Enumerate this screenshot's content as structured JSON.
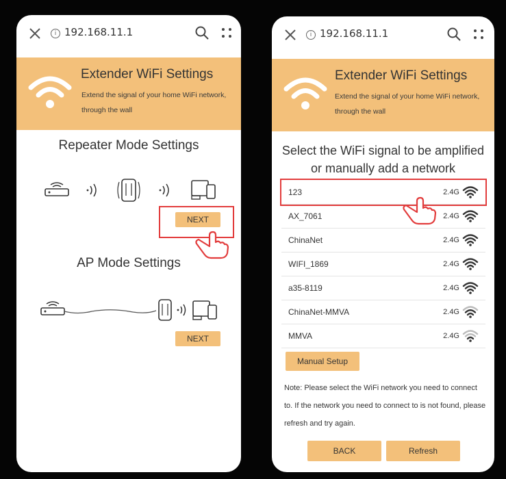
{
  "left": {
    "url": "192.168.11.1",
    "banner": {
      "title": "Extender WiFi Settings",
      "subtitle": "Extend the signal of your home WiFi network, through the wall"
    },
    "repeater": {
      "title": "Repeater Mode Settings",
      "next_label": "NEXT"
    },
    "ap": {
      "title": "AP Mode Settings",
      "next_label": "NEXT"
    }
  },
  "right": {
    "url": "192.168.11.1",
    "banner": {
      "title": "Extender WiFi Settings",
      "subtitle": "Extend the signal of your home WiFi network, through the wall"
    },
    "heading_line1": "Select the WiFi signal to be amplified",
    "heading_line2": "or manually add a network",
    "networks": [
      {
        "ssid": "123",
        "band": "2.4G",
        "signal_bars": 4
      },
      {
        "ssid": "AX_7061",
        "band": "2.4G",
        "signal_bars": 4
      },
      {
        "ssid": "ChinaNet",
        "band": "2.4G",
        "signal_bars": 4
      },
      {
        "ssid": "WIFI_1869",
        "band": "2.4G",
        "signal_bars": 4
      },
      {
        "ssid": "a35-8119",
        "band": "2.4G",
        "signal_bars": 4
      },
      {
        "ssid": "ChinaNet-MMVA",
        "band": "2.4G",
        "signal_bars": 3
      },
      {
        "ssid": "MMVA",
        "band": "2.4G",
        "signal_bars": 2
      }
    ],
    "manual_setup_label": "Manual Setup",
    "note": "Note: Please select the WiFi network you need to connect to. If the network you need to connect to is not found, please refresh and try again.",
    "back_label": "BACK",
    "refresh_label": "Refresh"
  },
  "colors": {
    "banner": "#f3c07a",
    "highlight": "#e23b3b",
    "background": "#050505"
  },
  "icons": [
    "close-icon",
    "info-icon",
    "search-icon",
    "menu-dots-icon",
    "wifi-icon",
    "router-icon",
    "extender-icon",
    "devices-icon",
    "hand-pointer-icon"
  ]
}
